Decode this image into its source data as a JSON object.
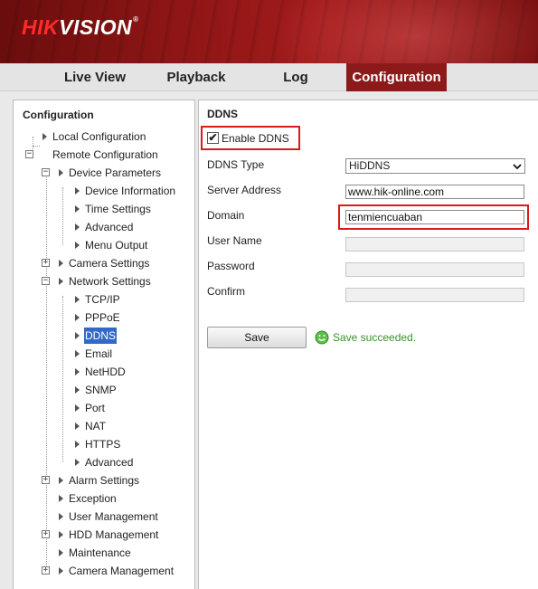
{
  "logo": {
    "text_brand": "HIK",
    "text_rest": "VISION",
    "trademark": "®"
  },
  "nav": {
    "tabs": [
      {
        "label": "Live View"
      },
      {
        "label": "Playback"
      },
      {
        "label": "Log"
      },
      {
        "label": "Configuration",
        "active": true
      }
    ]
  },
  "sidebar": {
    "title": "Configuration",
    "items": [
      {
        "label": "Local Configuration"
      },
      {
        "label": "Remote Configuration",
        "expanded": true
      },
      {
        "label": "Device Parameters",
        "expanded": true
      },
      {
        "label": "Device Information"
      },
      {
        "label": "Time Settings"
      },
      {
        "label": "Advanced"
      },
      {
        "label": "Menu Output"
      },
      {
        "label": "Camera Settings",
        "expanded": false
      },
      {
        "label": "Network Settings",
        "expanded": true
      },
      {
        "label": "TCP/IP"
      },
      {
        "label": "PPPoE"
      },
      {
        "label": "DDNS",
        "selected": true
      },
      {
        "label": "Email"
      },
      {
        "label": "NetHDD"
      },
      {
        "label": "SNMP"
      },
      {
        "label": "Port"
      },
      {
        "label": "NAT"
      },
      {
        "label": "HTTPS"
      },
      {
        "label": "Advanced"
      },
      {
        "label": "Alarm Settings",
        "expanded": false
      },
      {
        "label": "Exception"
      },
      {
        "label": "User Management"
      },
      {
        "label": "HDD Management",
        "expanded": false
      },
      {
        "label": "Maintenance"
      },
      {
        "label": "Camera Management",
        "expanded": false
      }
    ]
  },
  "main": {
    "section_title": "DDNS",
    "enable_ddns": {
      "label": "Enable DDNS",
      "checked": true,
      "mark": "✔"
    },
    "fields": {
      "ddns_type": {
        "label": "DDNS Type",
        "value": "HiDDNS"
      },
      "server_address": {
        "label": "Server Address",
        "value": "www.hik-online.com"
      },
      "domain": {
        "label": "Domain",
        "value": "tenmiencuaban"
      },
      "user_name": {
        "label": "User Name",
        "value": ""
      },
      "password": {
        "label": "Password",
        "value": ""
      },
      "confirm": {
        "label": "Confirm",
        "value": ""
      }
    },
    "save_label": "Save",
    "status_text": "Save succeeded."
  },
  "colors": {
    "accent": "#8c1a1a",
    "highlight": "#d81c1c",
    "success": "#3b8f2e",
    "selection": "#3169c6"
  }
}
